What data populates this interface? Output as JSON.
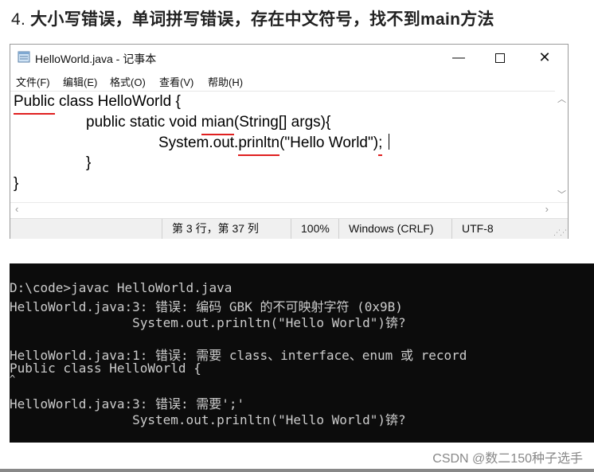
{
  "heading": {
    "number": "4.",
    "text": "大小写错误，单词拼写错误，存在中文符号，找不到main方法"
  },
  "notepad": {
    "title": "HelloWorld.java - 记事本",
    "menu": [
      "文件(F)",
      "编辑(E)",
      "格式(O)",
      "查看(V)",
      "帮助(H)"
    ],
    "code": {
      "line1": {
        "err": "Public",
        "rest": " class HelloWorld {"
      },
      "line2": {
        "pre": "public static void ",
        "err": "mian",
        "rest": "(String[] args){"
      },
      "line3": {
        "pre": "System.out.",
        "err": "prinltn",
        "mid": "(\"Hello World\")",
        "err2": ";"
      },
      "line4": "}",
      "line5": "}"
    },
    "status": {
      "position": "第 3 行，第 37 列",
      "zoom": "100%",
      "line_ending": "Windows (CRLF)",
      "encoding": "UTF-8"
    }
  },
  "console": [
    "D:\\code>javac HelloWorld.java",
    "HelloWorld.java:3: 错误: 编码 GBK 的不可映射字符 (0x9B)",
    "                System.out.prinltn(\"Hello World\")锛?",
    "",
    "HelloWorld.java:1: 错误: 需要 class、interface、enum 或 record",
    "Public class HelloWorld {",
    "^",
    "HelloWorld.java:3: 错误: 需要';'",
    "                System.out.prinltn(\"Hello World\")锛?"
  ],
  "watermark": "CSDN @数二150种子选手"
}
